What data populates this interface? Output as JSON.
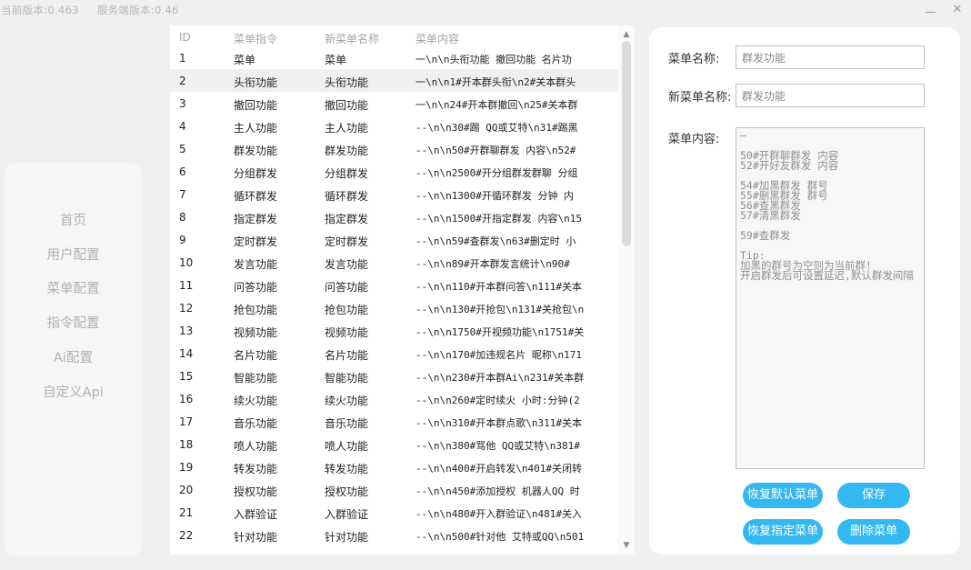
{
  "header": {
    "current_version": "当前版本:0.463",
    "server_version": "服务端版本:0.46"
  },
  "window": {
    "minimize_icon": "minimize-icon",
    "close_icon": "close-icon",
    "close_glyph": "✕"
  },
  "sidebar": {
    "items": [
      {
        "label": "首页"
      },
      {
        "label": "用户配置"
      },
      {
        "label": "菜单配置"
      },
      {
        "label": "指令配置"
      },
      {
        "label": "Ai配置"
      },
      {
        "label": "自定义Api"
      }
    ]
  },
  "table": {
    "headers": {
      "id": "ID",
      "cmd": "菜单指令",
      "new_name": "新菜单名称",
      "content": "菜单内容"
    },
    "selected_index": 1,
    "rows": [
      {
        "id": "1",
        "cmd": "菜单",
        "new_name": "菜单",
        "content": "一\\n\\n头衔功能 撤回功能 名片功"
      },
      {
        "id": "2",
        "cmd": "头衔功能",
        "new_name": "头衔功能",
        "content": "一\\n\\n1#开本群头衔\\n2#关本群头"
      },
      {
        "id": "3",
        "cmd": "撤回功能",
        "new_name": "撤回功能",
        "content": "一\\n\\n24#开本群撤回\\n25#关本群"
      },
      {
        "id": "4",
        "cmd": "主人功能",
        "new_name": "主人功能",
        "content": "--\\n\\n30#踢 QQ或艾特\\n31#踢黑"
      },
      {
        "id": "5",
        "cmd": "群发功能",
        "new_name": "群发功能",
        "content": "--\\n\\n50#开群聊群发 内容\\n52#"
      },
      {
        "id": "6",
        "cmd": "分组群发",
        "new_name": "分组群发",
        "content": "--\\n\\n2500#开分组群发群聊 分组"
      },
      {
        "id": "7",
        "cmd": "循环群发",
        "new_name": "循环群发",
        "content": "--\\n\\n1300#开循环群发 分钟 内"
      },
      {
        "id": "8",
        "cmd": "指定群发",
        "new_name": "指定群发",
        "content": "--\\n\\n1500#开指定群发 内容\\n15"
      },
      {
        "id": "9",
        "cmd": "定时群发",
        "new_name": "定时群发",
        "content": "--\\n\\n59#查群发\\n63#删定时 小"
      },
      {
        "id": "10",
        "cmd": "发言功能",
        "new_name": "发言功能",
        "content": "--\\n\\n89#开本群发言统计\\n90#"
      },
      {
        "id": "11",
        "cmd": "问答功能",
        "new_name": "问答功能",
        "content": "--\\n\\n110#开本群问答\\n111#关本"
      },
      {
        "id": "12",
        "cmd": "抢包功能",
        "new_name": "抢包功能",
        "content": "--\\n\\n130#开抢包\\n131#关抢包\\n"
      },
      {
        "id": "13",
        "cmd": "视频功能",
        "new_name": "视频功能",
        "content": "--\\n\\n1750#开视频功能\\n1751#关"
      },
      {
        "id": "14",
        "cmd": "名片功能",
        "new_name": "名片功能",
        "content": "--\\n\\n170#加违规名片 昵称\\n171"
      },
      {
        "id": "15",
        "cmd": "智能功能",
        "new_name": "智能功能",
        "content": "--\\n\\n230#开本群Ai\\n231#关本群"
      },
      {
        "id": "16",
        "cmd": "续火功能",
        "new_name": "续火功能",
        "content": "--\\n\\n260#定时续火 小时:分钟(2"
      },
      {
        "id": "17",
        "cmd": "音乐功能",
        "new_name": "音乐功能",
        "content": "--\\n\\n310#开本群点歌\\n311#关本"
      },
      {
        "id": "18",
        "cmd": "喷人功能",
        "new_name": "喷人功能",
        "content": "--\\n\\n380#骂他 QQ或艾特\\n381#"
      },
      {
        "id": "19",
        "cmd": "转发功能",
        "new_name": "转发功能",
        "content": "--\\n\\n400#开启转发\\n401#关闭转"
      },
      {
        "id": "20",
        "cmd": "授权功能",
        "new_name": "授权功能",
        "content": "--\\n\\n450#添加授权 机器人QQ 时"
      },
      {
        "id": "21",
        "cmd": "入群验证",
        "new_name": "入群验证",
        "content": "--\\n\\n480#开入群验证\\n481#关入"
      },
      {
        "id": "22",
        "cmd": "针对功能",
        "new_name": "针对功能",
        "content": "--\\n\\n500#针对他 艾特或QQ\\n501"
      },
      {
        "id": "23",
        "cmd": "—",
        "new_name": "—",
        "content": "—"
      }
    ]
  },
  "scrollbar": {
    "up_glyph": "▲",
    "down_glyph": "▼",
    "up_icon": "scroll-up-icon",
    "down_icon": "scroll-down-icon"
  },
  "editor": {
    "menu_name_label": "菜单名称:",
    "menu_name_value": "群发功能",
    "new_name_label": "新菜单名称:",
    "new_name_value": "群发功能",
    "content_label": "菜单内容:",
    "content_value": "—\n\n50#开群聊群发 内容\n52#开好友群发 内容\n\n54#加黑群发 群号\n55#删黑群发 群号\n56#查黑群发\n57#清黑群发\n\n59#查群发\n\nTip:\n加黑的群号为空则为当前群!\n开启群发后可设置延迟,默认群发间隔"
  },
  "buttons": {
    "restore_default": "恢复默认菜单",
    "save": "保存",
    "restore_specified": "恢复指定菜单",
    "delete": "删除菜单"
  },
  "colors": {
    "accent": "#33b8f2",
    "selected_row": "#f0f0f0"
  }
}
